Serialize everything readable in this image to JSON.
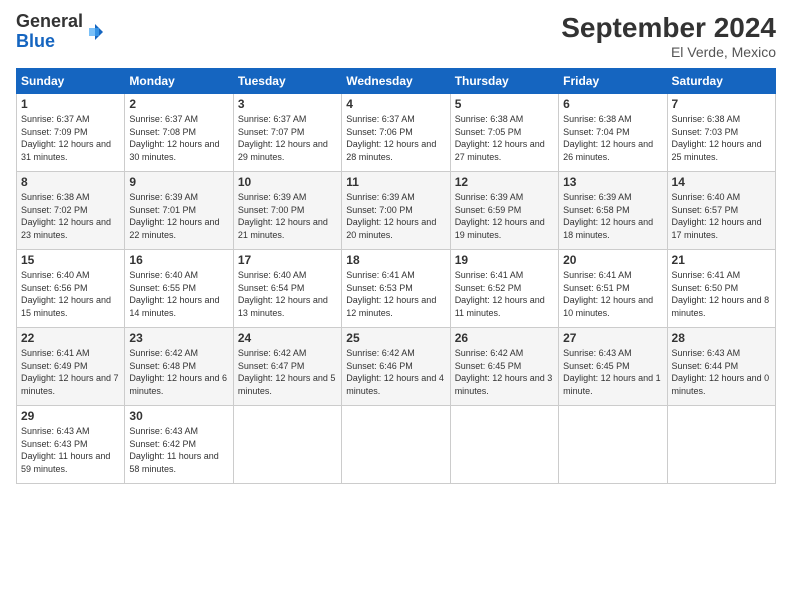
{
  "logo": {
    "general": "General",
    "blue": "Blue"
  },
  "header": {
    "month": "September 2024",
    "location": "El Verde, Mexico"
  },
  "weekdays": [
    "Sunday",
    "Monday",
    "Tuesday",
    "Wednesday",
    "Thursday",
    "Friday",
    "Saturday"
  ],
  "weeks": [
    [
      {
        "day": "1",
        "sunrise": "Sunrise: 6:37 AM",
        "sunset": "Sunset: 7:09 PM",
        "daylight": "Daylight: 12 hours and 31 minutes."
      },
      {
        "day": "2",
        "sunrise": "Sunrise: 6:37 AM",
        "sunset": "Sunset: 7:08 PM",
        "daylight": "Daylight: 12 hours and 30 minutes."
      },
      {
        "day": "3",
        "sunrise": "Sunrise: 6:37 AM",
        "sunset": "Sunset: 7:07 PM",
        "daylight": "Daylight: 12 hours and 29 minutes."
      },
      {
        "day": "4",
        "sunrise": "Sunrise: 6:37 AM",
        "sunset": "Sunset: 7:06 PM",
        "daylight": "Daylight: 12 hours and 28 minutes."
      },
      {
        "day": "5",
        "sunrise": "Sunrise: 6:38 AM",
        "sunset": "Sunset: 7:05 PM",
        "daylight": "Daylight: 12 hours and 27 minutes."
      },
      {
        "day": "6",
        "sunrise": "Sunrise: 6:38 AM",
        "sunset": "Sunset: 7:04 PM",
        "daylight": "Daylight: 12 hours and 26 minutes."
      },
      {
        "day": "7",
        "sunrise": "Sunrise: 6:38 AM",
        "sunset": "Sunset: 7:03 PM",
        "daylight": "Daylight: 12 hours and 25 minutes."
      }
    ],
    [
      {
        "day": "8",
        "sunrise": "Sunrise: 6:38 AM",
        "sunset": "Sunset: 7:02 PM",
        "daylight": "Daylight: 12 hours and 23 minutes."
      },
      {
        "day": "9",
        "sunrise": "Sunrise: 6:39 AM",
        "sunset": "Sunset: 7:01 PM",
        "daylight": "Daylight: 12 hours and 22 minutes."
      },
      {
        "day": "10",
        "sunrise": "Sunrise: 6:39 AM",
        "sunset": "Sunset: 7:00 PM",
        "daylight": "Daylight: 12 hours and 21 minutes."
      },
      {
        "day": "11",
        "sunrise": "Sunrise: 6:39 AM",
        "sunset": "Sunset: 7:00 PM",
        "daylight": "Daylight: 12 hours and 20 minutes."
      },
      {
        "day": "12",
        "sunrise": "Sunrise: 6:39 AM",
        "sunset": "Sunset: 6:59 PM",
        "daylight": "Daylight: 12 hours and 19 minutes."
      },
      {
        "day": "13",
        "sunrise": "Sunrise: 6:39 AM",
        "sunset": "Sunset: 6:58 PM",
        "daylight": "Daylight: 12 hours and 18 minutes."
      },
      {
        "day": "14",
        "sunrise": "Sunrise: 6:40 AM",
        "sunset": "Sunset: 6:57 PM",
        "daylight": "Daylight: 12 hours and 17 minutes."
      }
    ],
    [
      {
        "day": "15",
        "sunrise": "Sunrise: 6:40 AM",
        "sunset": "Sunset: 6:56 PM",
        "daylight": "Daylight: 12 hours and 15 minutes."
      },
      {
        "day": "16",
        "sunrise": "Sunrise: 6:40 AM",
        "sunset": "Sunset: 6:55 PM",
        "daylight": "Daylight: 12 hours and 14 minutes."
      },
      {
        "day": "17",
        "sunrise": "Sunrise: 6:40 AM",
        "sunset": "Sunset: 6:54 PM",
        "daylight": "Daylight: 12 hours and 13 minutes."
      },
      {
        "day": "18",
        "sunrise": "Sunrise: 6:41 AM",
        "sunset": "Sunset: 6:53 PM",
        "daylight": "Daylight: 12 hours and 12 minutes."
      },
      {
        "day": "19",
        "sunrise": "Sunrise: 6:41 AM",
        "sunset": "Sunset: 6:52 PM",
        "daylight": "Daylight: 12 hours and 11 minutes."
      },
      {
        "day": "20",
        "sunrise": "Sunrise: 6:41 AM",
        "sunset": "Sunset: 6:51 PM",
        "daylight": "Daylight: 12 hours and 10 minutes."
      },
      {
        "day": "21",
        "sunrise": "Sunrise: 6:41 AM",
        "sunset": "Sunset: 6:50 PM",
        "daylight": "Daylight: 12 hours and 8 minutes."
      }
    ],
    [
      {
        "day": "22",
        "sunrise": "Sunrise: 6:41 AM",
        "sunset": "Sunset: 6:49 PM",
        "daylight": "Daylight: 12 hours and 7 minutes."
      },
      {
        "day": "23",
        "sunrise": "Sunrise: 6:42 AM",
        "sunset": "Sunset: 6:48 PM",
        "daylight": "Daylight: 12 hours and 6 minutes."
      },
      {
        "day": "24",
        "sunrise": "Sunrise: 6:42 AM",
        "sunset": "Sunset: 6:47 PM",
        "daylight": "Daylight: 12 hours and 5 minutes."
      },
      {
        "day": "25",
        "sunrise": "Sunrise: 6:42 AM",
        "sunset": "Sunset: 6:46 PM",
        "daylight": "Daylight: 12 hours and 4 minutes."
      },
      {
        "day": "26",
        "sunrise": "Sunrise: 6:42 AM",
        "sunset": "Sunset: 6:45 PM",
        "daylight": "Daylight: 12 hours and 3 minutes."
      },
      {
        "day": "27",
        "sunrise": "Sunrise: 6:43 AM",
        "sunset": "Sunset: 6:45 PM",
        "daylight": "Daylight: 12 hours and 1 minute."
      },
      {
        "day": "28",
        "sunrise": "Sunrise: 6:43 AM",
        "sunset": "Sunset: 6:44 PM",
        "daylight": "Daylight: 12 hours and 0 minutes."
      }
    ],
    [
      {
        "day": "29",
        "sunrise": "Sunrise: 6:43 AM",
        "sunset": "Sunset: 6:43 PM",
        "daylight": "Daylight: 11 hours and 59 minutes."
      },
      {
        "day": "30",
        "sunrise": "Sunrise: 6:43 AM",
        "sunset": "Sunset: 6:42 PM",
        "daylight": "Daylight: 11 hours and 58 minutes."
      },
      null,
      null,
      null,
      null,
      null
    ]
  ]
}
